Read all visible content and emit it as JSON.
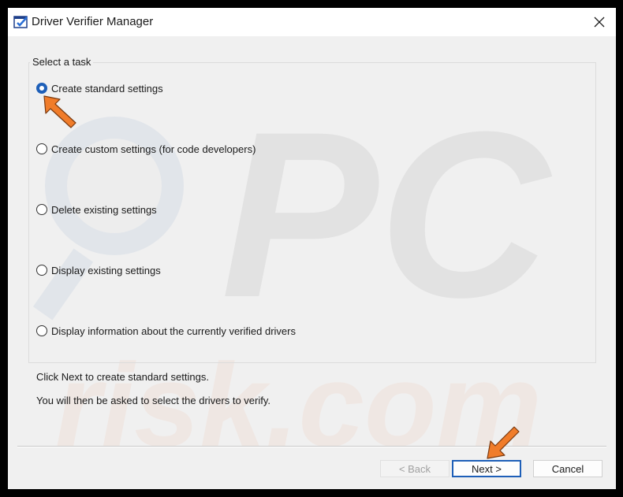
{
  "window": {
    "title": "Driver Verifier Manager",
    "app_icon": "driver-verifier-icon",
    "close_icon": "close-icon"
  },
  "task_group": {
    "label": "Select a task",
    "options": [
      {
        "label": "Create standard settings",
        "checked": true
      },
      {
        "label": "Create custom settings (for code developers)",
        "checked": false
      },
      {
        "label": "Delete existing settings",
        "checked": false
      },
      {
        "label": "Display existing settings",
        "checked": false
      },
      {
        "label": "Display information about the currently verified drivers",
        "checked": false
      }
    ]
  },
  "info": {
    "line1": "Click Next to create standard settings.",
    "line2": "You will then be asked to select the drivers to verify."
  },
  "buttons": {
    "back": "< Back",
    "next": "Next >",
    "cancel": "Cancel"
  },
  "watermark": {
    "text1": "PC",
    "text2": "risk.com"
  },
  "colors": {
    "accent": "#1e5fb8",
    "arrow": "#f07c2a",
    "window_bg": "#f0f0f0"
  }
}
